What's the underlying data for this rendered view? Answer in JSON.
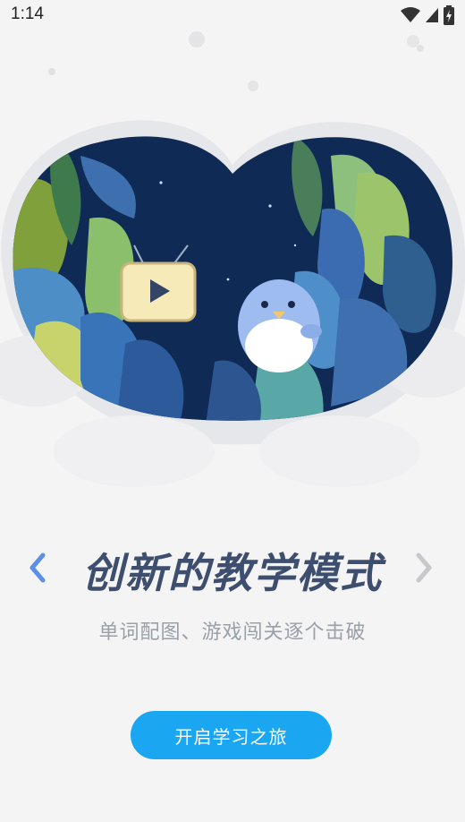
{
  "status_bar": {
    "time": "1:14",
    "icons": [
      "wifi-icon",
      "cellular-signal-icon",
      "battery-charging-icon"
    ]
  },
  "hero": {
    "illustration": "heart-shaped night scene with cactus plants, leaves, a TV with play button, and a blue bird"
  },
  "carousel": {
    "title": "创新的教学模式",
    "subtitle": "单词配图、游戏闯关逐个击破",
    "prev_icon": "chevron-left-icon",
    "next_icon": "chevron-right-icon"
  },
  "cta": {
    "label": "开启学习之旅"
  },
  "colors": {
    "accent": "#1ba6f2",
    "title": "#3d4e6e",
    "subtitle": "#9aa0a8",
    "prev_arrow": "#5b8fe8",
    "next_arrow": "#c8c8cc",
    "night_sky": "#0f2a55"
  }
}
